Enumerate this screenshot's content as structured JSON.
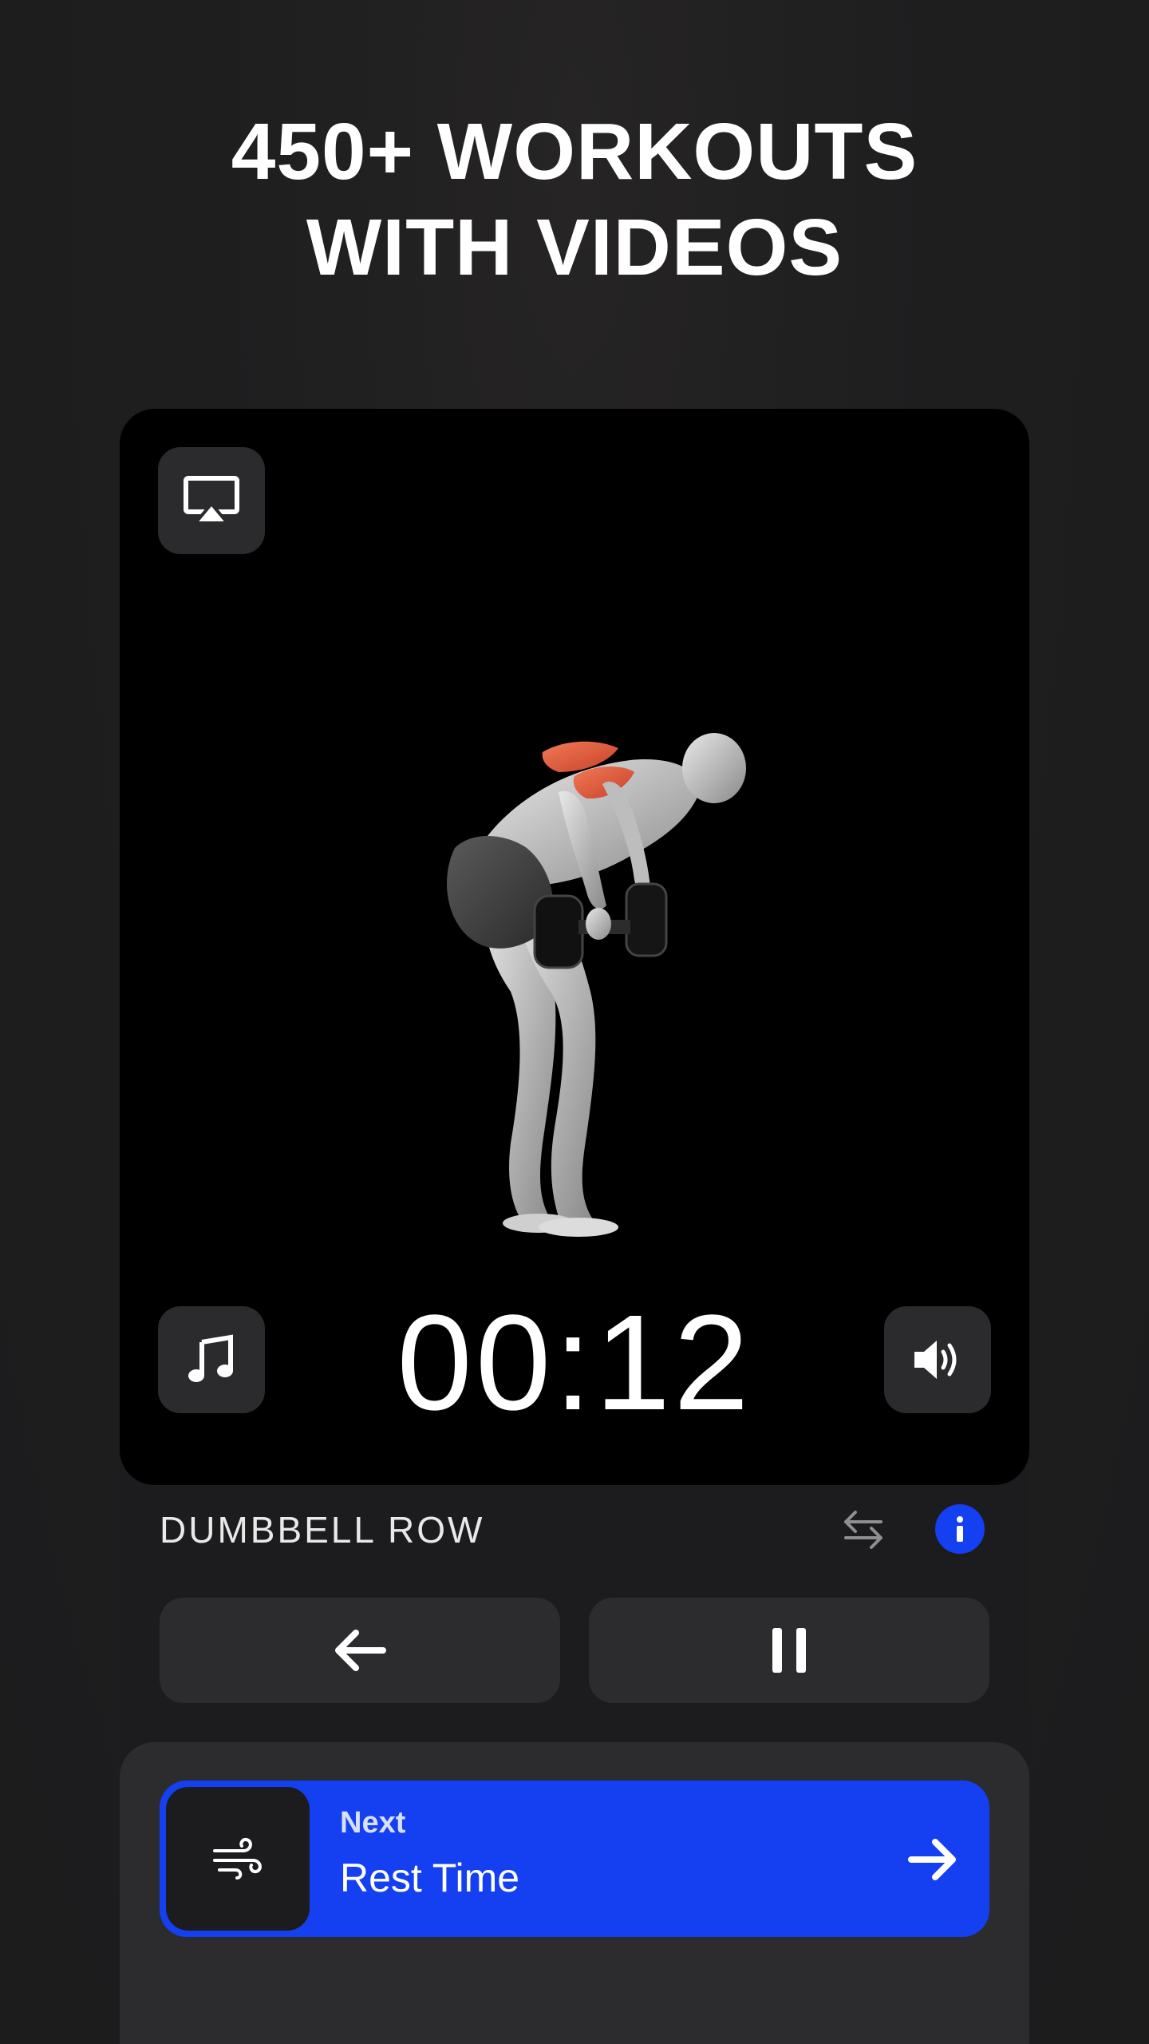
{
  "headline": {
    "line1": "450+ WORKOUTS",
    "line2": "WITH VIDEOS"
  },
  "player": {
    "timer": "00:12",
    "exercise_name": "DUMBBELL ROW"
  },
  "next": {
    "label": "Next",
    "title": "Rest Time"
  },
  "icons": {
    "airplay": "airplay-icon",
    "music": "music-note-icon",
    "sound": "speaker-volume-icon",
    "swap": "swap-arrows-icon",
    "info": "info-icon",
    "back": "arrow-left-icon",
    "pause": "pause-icon",
    "rest": "wind-icon",
    "next": "arrow-right-icon"
  },
  "colors": {
    "accent": "#1440f2",
    "background": "#1e1e1f",
    "video_background": "#000000",
    "muscle_highlight": "#e0573a"
  }
}
